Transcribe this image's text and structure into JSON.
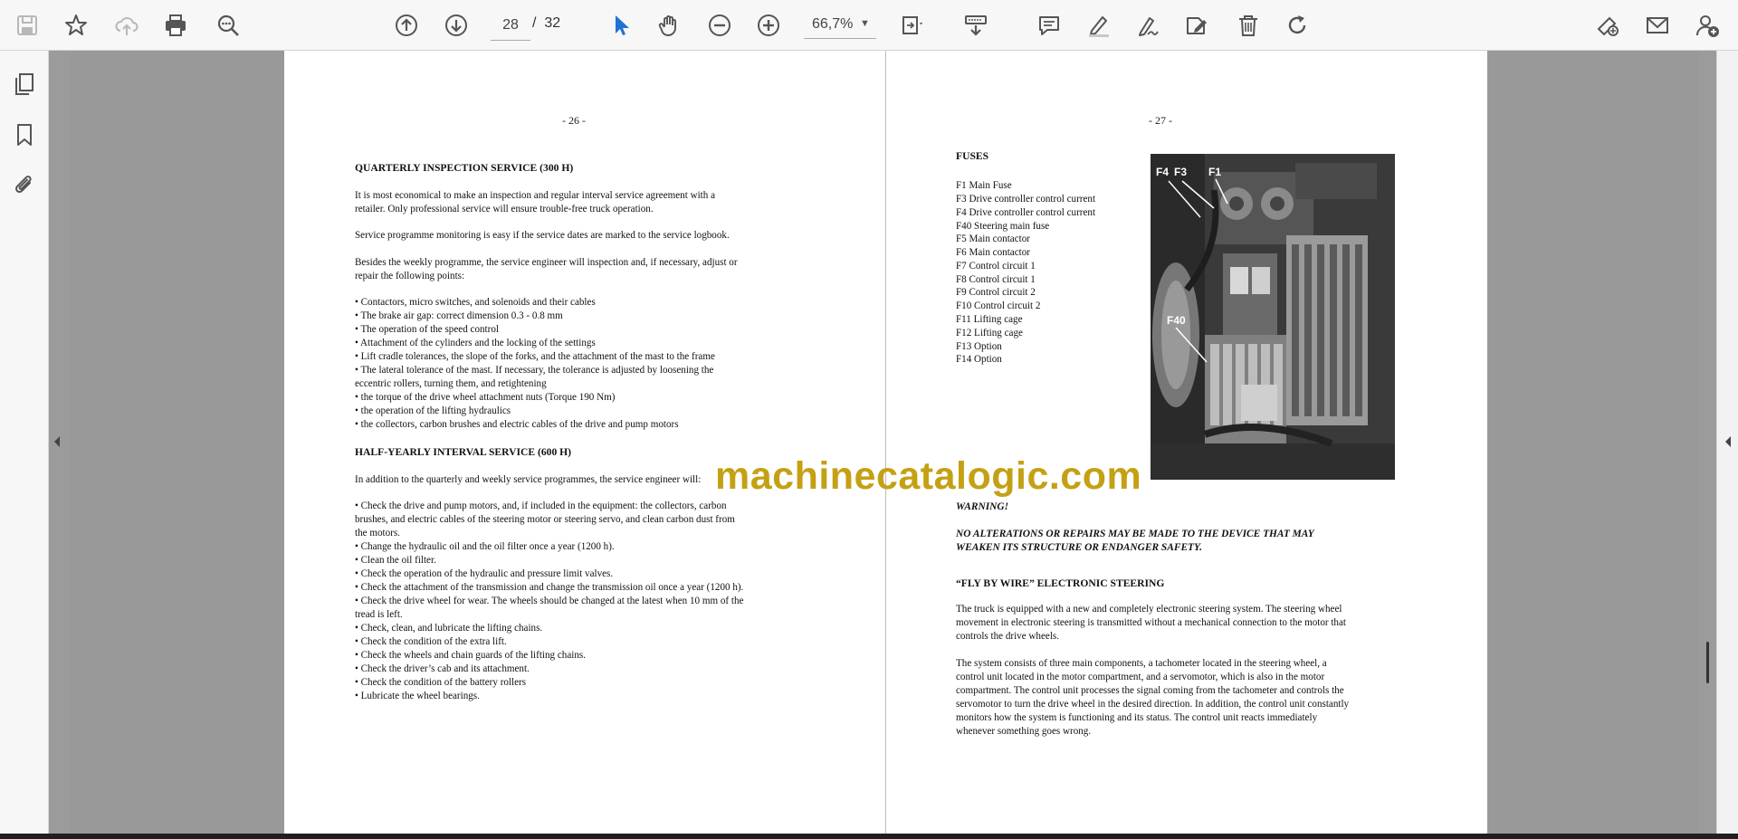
{
  "toolbar": {
    "current_page": "28",
    "page_separator": "/",
    "total_pages": "32",
    "zoom": "66,7%",
    "icons": [
      "save-icon",
      "bookmark-star-icon",
      "cloud-upload-icon",
      "print-icon",
      "zoom-search-icon",
      "page-up-icon",
      "page-down-icon",
      "select-cursor-icon",
      "hand-tool-icon",
      "zoom-out-icon",
      "zoom-in-icon",
      "fit-page-icon",
      "scroll-mode-icon",
      "comment-icon",
      "highlight-icon",
      "draw-icon",
      "stamp-icon",
      "delete-icon",
      "rotate-icon",
      "share-link-icon",
      "email-icon",
      "add-user-icon"
    ]
  },
  "leftnav": {
    "icons": [
      "pages-thumbnail-icon",
      "bookmarks-icon",
      "attachments-icon"
    ]
  },
  "left_page": {
    "page_number": "- 26 -",
    "heading1": "QUARTERLY INSPECTION SERVICE (300 H)",
    "para1": [
      "It is most economical to make an inspection and regular interval service agreement with a",
      "retailer. Only professional service will ensure trouble-free truck operation."
    ],
    "para2": "Service programme monitoring is easy if the service dates are marked to the service logbook.",
    "para3": [
      "Besides the weekly programme, the service engineer will inspection and, if necessary, adjust or",
      "repair the following points:"
    ],
    "list1": [
      "• Contactors, micro switches, and solenoids and their cables",
      "• The brake air gap: correct dimension 0.3 - 0.8 mm",
      "• The operation of the speed control",
      "• Attachment of the cylinders and the locking of the settings",
      "• Lift cradle tolerances, the slope of the forks, and the attachment of the mast to the frame",
      "• The lateral tolerance of the mast. If necessary, the tolerance is adjusted by loosening the",
      "eccentric rollers, turning them, and retightening",
      "• the torque of the drive wheel attachment nuts (Torque 190 Nm)",
      "• the operation of the lifting hydraulics",
      "• the collectors, carbon brushes and electric cables of the drive and pump motors"
    ],
    "heading2": "HALF-YEARLY INTERVAL SERVICE (600 H)",
    "para4": "In addition to the quarterly and weekly service programmes, the service engineer will:",
    "list2": [
      "• Check the drive and pump motors, and, if included in the equipment: the collectors, carbon",
      "brushes, and electric cables of the steering motor or steering servo, and clean carbon dust from",
      "the motors.",
      "• Change the hydraulic oil and the oil filter once a year (1200 h).",
      "• Clean the oil filter.",
      "• Check the operation of the hydraulic and pressure limit valves.",
      "• Check the attachment of the transmission and change the transmission oil once a year (1200 h).",
      "• Check the drive wheel for wear. The wheels should be changed at the latest when 10 mm of the",
      "tread is left.",
      "• Check, clean, and lubricate the lifting chains.",
      "• Check the condition of the extra lift.",
      "• Check the wheels and chain guards of the lifting chains.",
      "• Check the driver’s cab and its attachment.",
      "• Check the condition of the battery rollers",
      "• Lubricate the wheel bearings."
    ]
  },
  "right_page": {
    "page_number": "- 27 -",
    "fuses_heading": "FUSES",
    "fuses": [
      "F1 Main Fuse",
      "F3 Drive controller control current",
      "F4 Drive controller control current",
      "F40 Steering main fuse",
      "F5 Main contactor",
      "F6 Main contactor",
      "F7 Control circuit 1",
      "F8 Control circuit 1",
      "F9 Control circuit 2",
      "F10 Control circuit 2",
      "F11 Lifting cage",
      "F12 Lifting cage",
      "F13 Option",
      "F14 Option"
    ],
    "photo_labels": [
      "F4",
      "F3",
      "F1",
      "F40"
    ],
    "warning_title": "WARNING!",
    "warning_text": [
      "NO ALTERATIONS OR REPAIRS MAY BE MADE TO THE DEVICE THAT MAY",
      "WEAKEN ITS STRUCTURE OR ENDANGER SAFETY."
    ],
    "steering_heading": "“FLY BY WIRE” ELECTRONIC STEERING",
    "steering_para1": [
      "The truck is equipped with a new and completely electronic steering system. The steering wheel",
      "movement in electronic steering is transmitted without a mechanical connection to the motor that",
      "controls the drive wheels."
    ],
    "steering_para2": [
      "The system consists of three main components, a tachometer located in the steering wheel, a",
      "control unit located in the motor compartment, and a servomotor, which is also in the motor",
      "compartment. The control unit processes the signal coming from the tachometer and controls the",
      "servomotor to turn the drive wheel in the desired direction. In addition, the control unit constantly",
      "monitors how the system is functioning and its status. The control unit reacts immediately",
      "whenever something goes wrong."
    ]
  },
  "watermark": "machinecatalogic.com"
}
